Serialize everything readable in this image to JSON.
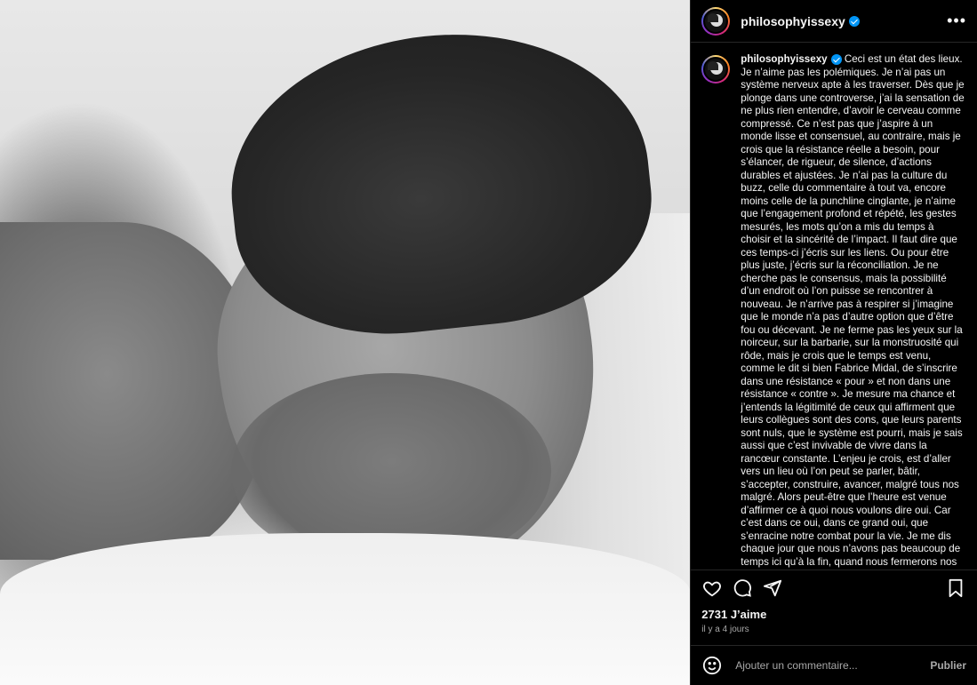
{
  "post": {
    "username": "philosophyissexy",
    "caption": "Ceci est un état des lieux. Je n’aime pas les polémiques. Je n’ai pas un système nerveux apte à les traverser. Dès que je plonge dans une controverse, j’ai la sensation de ne plus rien entendre, d’avoir le cerveau comme compressé. Ce n’est pas que j’aspire à un monde lisse et consensuel, au contraire, mais je crois que la résistance réelle a besoin, pour s’élancer, de rigueur, de silence, d’actions durables et ajustées. Je n’ai pas la culture du buzz, celle du commentaire à tout va, encore moins celle de la punchline cinglante, je n’aime que l’engagement profond et répété, les gestes mesurés, les mots qu’on a mis du temps à choisir et la sincérité de l’impact. Il faut dire que ces temps-ci j’écris sur les liens. Ou pour être plus juste, j’écris sur la réconciliation. Je ne cherche pas le consensus, mais la possibilité d’un endroit où l’on puisse se rencontrer à nouveau. Je n’arrive pas à respirer si j’imagine que le monde n’a pas d’autre option que d’être fou ou décevant. Je ne ferme pas les yeux sur la noirceur, sur la barbarie, sur la monstruosité qui rôde, mais je crois que le temps est venu, comme le dit si bien Fabrice Midal, de s’inscrire dans une résistance « pour » et non dans une résistance « contre ». Je mesure ma chance et j’entends la légitimité de ceux qui affirment que leurs collègues sont des cons, que leurs parents sont nuls, que le système est pourri, mais je sais aussi que c’est invivable de vivre dans la rancœur constante. L’enjeu je crois, est d’aller vers un lieu où l’on peut se parler, bâtir, s’accepter, construire, avancer, malgré tous nos malgré. Alors peut-être que l’heure est venue d’affirmer ce à quoi nous voulons dire oui. Car c’est dans ce oui, dans ce grand oui, que s’enracine notre combat pour la vie. Je me dis chaque jour que nous n’avons pas beaucoup de temps ici qu’à la fin, quand nous fermerons nos paupières, quand ce",
    "likes": "2731 J’aime",
    "time_ago": "il y a 4 jours"
  },
  "header": {
    "more_label": "•••"
  },
  "icons": {
    "like": "heart-icon",
    "comment": "comment-icon",
    "share": "share-icon",
    "save": "bookmark-icon",
    "emoji": "emoji-icon",
    "verified": "verified-badge-icon",
    "more": "more-options-icon"
  },
  "comment_box": {
    "placeholder": "Ajouter un commentaire...",
    "publish_label": "Publier"
  },
  "colors": {
    "background": "#000000",
    "text": "#f5f5f5",
    "muted": "#a8a8a8",
    "verified": "#0095f6",
    "border": "#262626"
  }
}
